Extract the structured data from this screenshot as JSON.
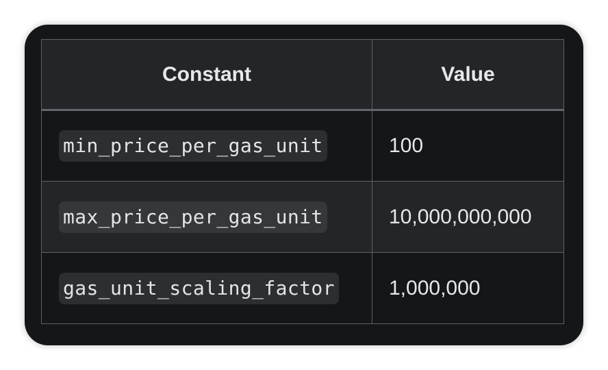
{
  "table": {
    "headers": [
      "Constant",
      "Value"
    ],
    "rows": [
      {
        "constant": "min_price_per_gas_unit",
        "value": "100"
      },
      {
        "constant": "max_price_per_gas_unit",
        "value": "10,000,000,000"
      },
      {
        "constant": "gas_unit_scaling_factor",
        "value": "1,000,000"
      }
    ]
  }
}
